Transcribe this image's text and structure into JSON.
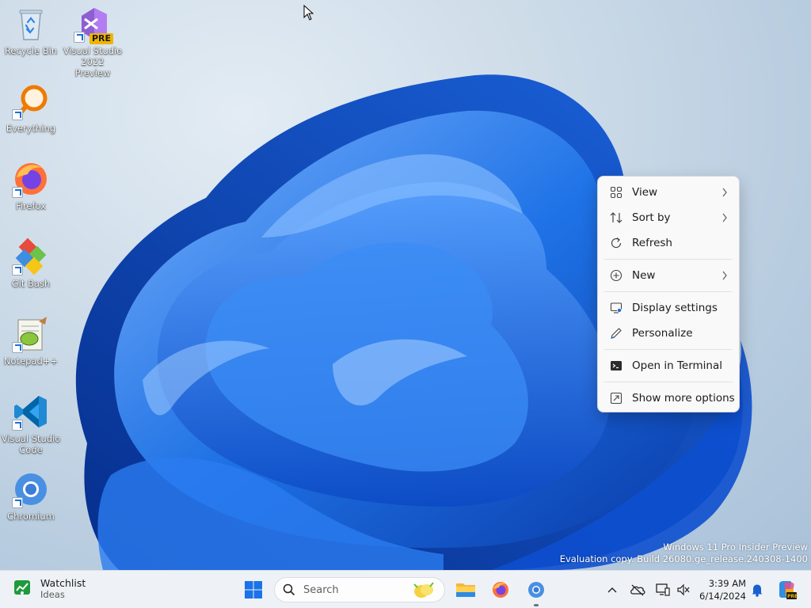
{
  "desktop": {
    "icons": [
      {
        "label": "Recycle Bin",
        "icon": "recycle-bin-icon"
      },
      {
        "label": "Visual Studio 2022 Preview",
        "badge": "PRE",
        "icon": "visual-studio-icon"
      },
      {
        "label": "Everything",
        "icon": "everything-search-icon"
      },
      {
        "label": "Firefox",
        "icon": "firefox-icon"
      },
      {
        "label": "Git Bash",
        "icon": "git-bash-icon"
      },
      {
        "label": "Notepad++",
        "icon": "notepad-plus-plus-icon"
      },
      {
        "label": "Visual Studio Code",
        "icon": "vscode-icon"
      },
      {
        "label": "Chromium",
        "icon": "chromium-icon"
      }
    ],
    "watermark": {
      "line1": "Windows 11 Pro Insider Preview",
      "line2": "Evaluation copy. Build 26080.ge_release.240308-1400"
    }
  },
  "context_menu": {
    "items": [
      {
        "label": "View",
        "icon": "grid-icon",
        "submenu": true
      },
      {
        "label": "Sort by",
        "icon": "sort-icon",
        "submenu": true
      },
      {
        "label": "Refresh",
        "icon": "refresh-icon",
        "submenu": false
      },
      {
        "label": "New",
        "icon": "plus-circle-icon",
        "submenu": true
      },
      {
        "label": "Display settings",
        "icon": "display-icon",
        "submenu": false
      },
      {
        "label": "Personalize",
        "icon": "pen-icon",
        "submenu": false
      },
      {
        "label": "Open in Terminal",
        "icon": "terminal-icon",
        "submenu": false
      },
      {
        "label": "Show more options",
        "icon": "expand-icon",
        "submenu": false
      }
    ]
  },
  "taskbar": {
    "widget": {
      "title": "Watchlist",
      "subtitle": "Ideas",
      "icon": "stock-chart-icon"
    },
    "search": {
      "placeholder": "Search"
    },
    "apps": [
      "start-icon",
      "file-explorer-icon",
      "firefox-icon",
      "chromium-icon"
    ],
    "tray": [
      "chevron-up-icon",
      "onedrive-icon",
      "network-icon",
      "volume-icon"
    ],
    "clock": {
      "time": "3:39 AM",
      "date": "6/14/2024"
    }
  },
  "colors": {
    "accent": "#1d6fd6",
    "wallpaper_blue": "#1f74e8",
    "taskbar_bg": "#eef2f6",
    "menu_bg": "#f9f9f9"
  }
}
